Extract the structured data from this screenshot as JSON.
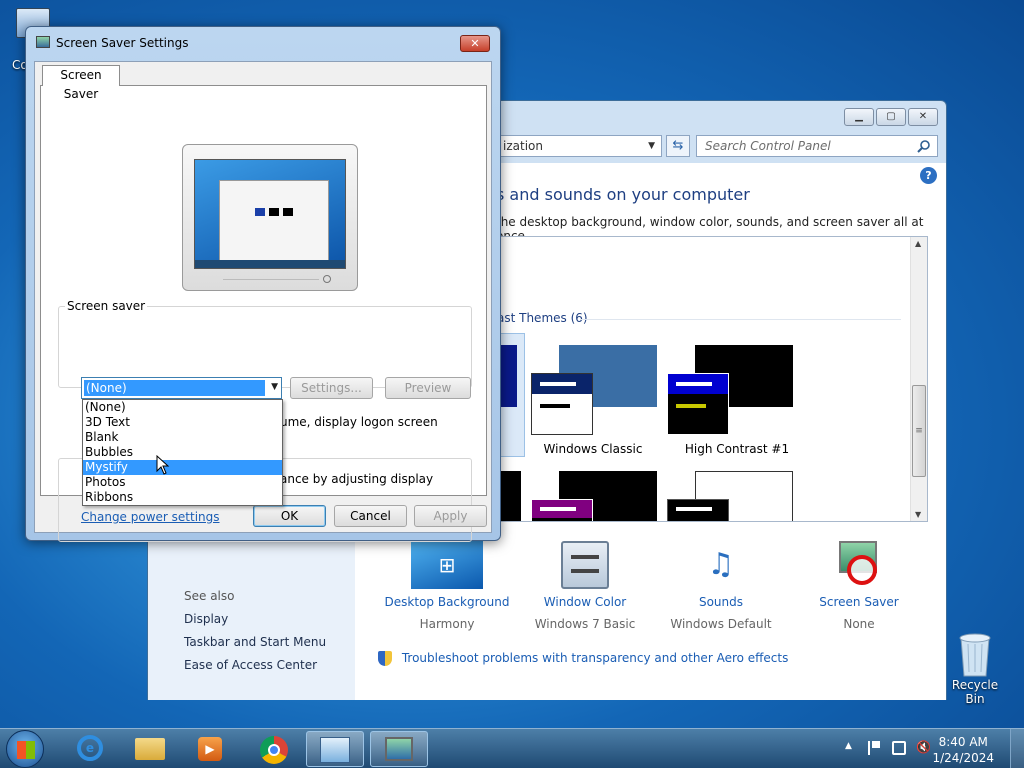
{
  "desktop": {
    "computer_label": "Co",
    "recycle_bin_label": "Recycle Bin"
  },
  "control_panel": {
    "address_text": "ization",
    "search_placeholder": "Search Control Panel",
    "heading": "s and sounds on your computer",
    "subheading": "the desktop background, window color, sounds, and screen saver all at once.",
    "section_label": "ast Themes (6)",
    "themes": [
      {
        "label": "Windows Classic"
      },
      {
        "label": "High Contrast #1"
      }
    ],
    "see_also_title": "See also",
    "side_links": [
      "Display",
      "Taskbar and Start Menu",
      "Ease of Access Center"
    ],
    "bottom_items": [
      {
        "title": "Desktop Background",
        "value": "Harmony"
      },
      {
        "title": "Window Color",
        "value": "Windows 7 Basic"
      },
      {
        "title": "Sounds",
        "value": "Windows Default"
      },
      {
        "title": "Screen Saver",
        "value": "None"
      }
    ],
    "troubleshoot_link": "Troubleshoot problems with transparency and other Aero effects",
    "title_buttons": {
      "minimize": "▁",
      "maximize": "▢",
      "close": "✕"
    }
  },
  "dialog": {
    "title": "Screen Saver Settings",
    "close": "✕",
    "tab": "Screen Saver",
    "group_label": "Screen saver",
    "selected": "(None)",
    "options": [
      "(None)",
      "3D Text",
      "Blank",
      "Bubbles",
      "Mystify",
      "Photos",
      "Ribbons"
    ],
    "highlighted_option": "Mystify",
    "settings_button": "Settings...",
    "preview_button": "Preview",
    "resume_text_partial": "ume, display logon screen",
    "power_text_partial": "ance by adjusting display",
    "power_link": "Change power settings",
    "ok": "OK",
    "cancel": "Cancel",
    "apply": "Apply"
  },
  "taskbar": {
    "time": "8:40 AM",
    "date": "1/24/2024",
    "tray_arrow": "▲"
  },
  "colors": {
    "link": "#1a5db4",
    "selection": "#3399ff",
    "heading": "#1e3f82"
  }
}
